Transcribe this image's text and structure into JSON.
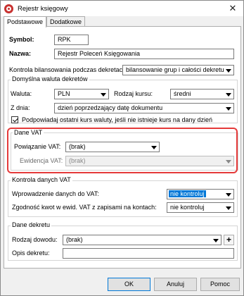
{
  "window": {
    "title": "Rejestr księgowy"
  },
  "tabs": [
    {
      "label": "Podstawowe"
    },
    {
      "label": "Dodatkowe"
    }
  ],
  "fields": {
    "symbol_label": "Symbol:",
    "symbol_value": "RPK",
    "nazwa_label": "Nazwa:",
    "nazwa_value": "Rejestr Poleceń Księgowania",
    "kontrola_label": "Kontrola bilansowania podczas dekretacji:",
    "kontrola_value": "bilansowanie grup i całości dekretu"
  },
  "waluta_group": {
    "title": "Domyślna waluta dekretów",
    "waluta_label": "Waluta:",
    "waluta_value": "PLN",
    "rodzaj_kursu_label": "Rodzaj kursu:",
    "rodzaj_kursu_value": "średni",
    "z_dnia_label": "Z dnia:",
    "z_dnia_value": "dzień poprzedzający datę dokumentu",
    "checkbox_label": "Podpowiadaj ostatni kurs waluty, jeśli nie istnieje kurs na dany dzień"
  },
  "vat_group": {
    "title": "Dane VAT",
    "powiazanie_label": "Powiązanie VAT:",
    "powiazanie_value": "(brak)",
    "ewidencja_label": "Ewidencja VAT:",
    "ewidencja_value": "(brak)"
  },
  "kontrola_vat_group": {
    "title": "Kontrola danych VAT",
    "wprowadzenie_label": "Wprowadzenie danych do VAT:",
    "wprowadzenie_value": "nie kontroluj",
    "zgodnosc_label": "Zgodność kwot w ewid. VAT z zapisami na kontach:",
    "zgodnosc_value": "nie kontroluj"
  },
  "dekret_group": {
    "title": "Dane dekretu",
    "rodzaj_dowodu_label": "Rodzaj dowodu:",
    "rodzaj_dowodu_value": "(brak)",
    "plus_label": "+",
    "opis_label": "Opis dekretu:"
  },
  "buttons": {
    "ok": "OK",
    "anuluj": "Anuluj",
    "pomoc": "Pomoc"
  },
  "colors": {
    "highlight": "#e53a3a",
    "selection": "#0078d7"
  }
}
